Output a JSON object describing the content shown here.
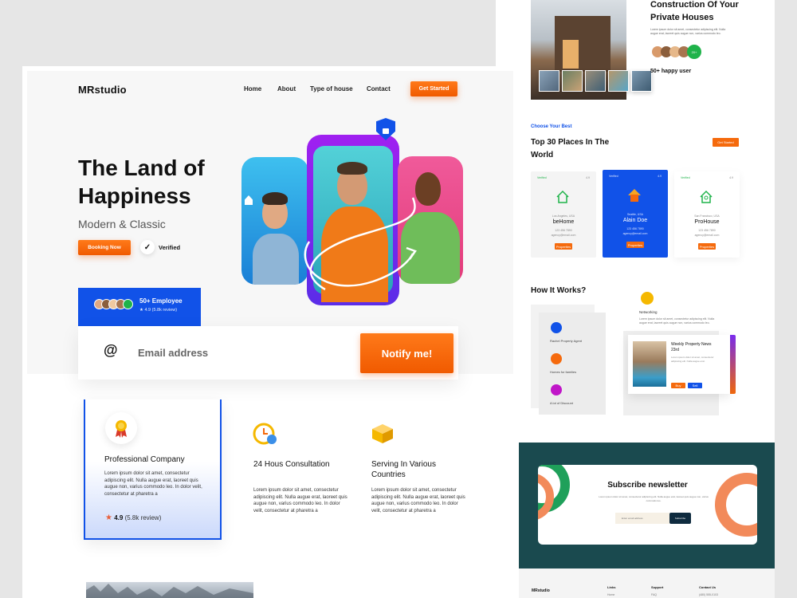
{
  "left": {
    "logo": "MRstudio",
    "nav": [
      "Home",
      "About",
      "Type of house",
      "Contact"
    ],
    "get_started": "Get Started",
    "hero_title": "The Land of Happiness",
    "hero_subtitle": "Modern & Classic",
    "booking": "Booking Now",
    "verified": "Verified",
    "employee": {
      "title": "50+ Employee",
      "rating": "★ 4.9 (5.8k review)"
    },
    "email": {
      "placeholder": "Email address",
      "button": "Notify me!"
    },
    "features": [
      {
        "title": "Professional Company",
        "text": "Lorem ipsum dolor sit amet, consectetur adipiscing elit. Nulla augue erat, laoreet quis augue non, varius commodo leo. In dolor velit, consectetur at pharetra a"
      },
      {
        "title": "24 Hous Consultation",
        "text": "Lorem ipsum dolor sit amet, consectetur adipiscing elit. Nulla augue erat, laoreet quis augue non, varius commodo leo. In dolor velit, consectetur at pharetra a"
      },
      {
        "title": "Serving In Various Countries",
        "text": "Lorem ipsum dolor sit amet, consectetur adipiscing elit. Nulla augue erat, laoreet quis augue non, varius commodo leo. In dolor velit, consectetur at pharetra a"
      }
    ],
    "rating_value": "4.9",
    "rating_count": "(5.8k review)",
    "colors": {
      "accent": "#f56a0d",
      "brand_blue": "#1152e8"
    }
  },
  "right": {
    "construction_title": "Construction Of Your Private Houses",
    "construction_text": "Lorem ipsum dolor sit amet, consectetur adipiscing elit. Nulla augue erat, laoreet quis augue non, varius commodo leo.",
    "happy_users": "50+ happy user",
    "happy_badge": "20+",
    "choose": "Choose Your Best",
    "places_title": "Top 30 Places In The World",
    "get_started": "Get Started",
    "places": [
      {
        "name": "beHome",
        "verified": "Verified",
        "rating": "4.9",
        "loc": "Los Angeles, USA",
        "phone": "123 456 7890",
        "mail": "agency@email.com",
        "btn": "Properties"
      },
      {
        "name": "Alain Doe",
        "verified": "Verified",
        "rating": "4.9",
        "loc": "Seattle, USA",
        "phone": "123 456 7890",
        "mail": "agency@email.com",
        "btn": "Properties"
      },
      {
        "name": "ProHouse",
        "verified": "Verified",
        "rating": "4.9",
        "loc": "San Francisco, USA",
        "phone": "123 456 7890",
        "mail": "agency@email.com",
        "btn": "Properties"
      }
    ],
    "how_title": "How It Works?",
    "networking": "Networking",
    "networking_text": "Lorem ipsum dolor sit amet, consectetur adipiscing elit. Nulla augue erat, laoreet quis augue non, varius commodo leo.",
    "steps": [
      "Rachel Property Agent",
      "Homes for families",
      "A lot of Discount"
    ],
    "weekly": {
      "title": "Weekly Property News 23rd",
      "text": "Lorem ipsum dolor sit amet, consectetur adipiscing elit. Nulla augue erat.",
      "buy": "Buy",
      "sell": "Sell"
    },
    "subscribe": {
      "title": "Subscribe newsletter",
      "text": "Lorem ipsum dolor sit amet, consectetur adipiscing elit. Nulla augue erat, laoreet quis augue non, varius commodo leo.",
      "placeholder": "Enter email address",
      "button": "Subscribe"
    },
    "footer": {
      "logo": "MRstudio",
      "cols": [
        "Links",
        "Support",
        "Contact Us"
      ],
      "items": [
        "Home",
        "FAQ",
        "(480) 555-0103"
      ]
    }
  }
}
